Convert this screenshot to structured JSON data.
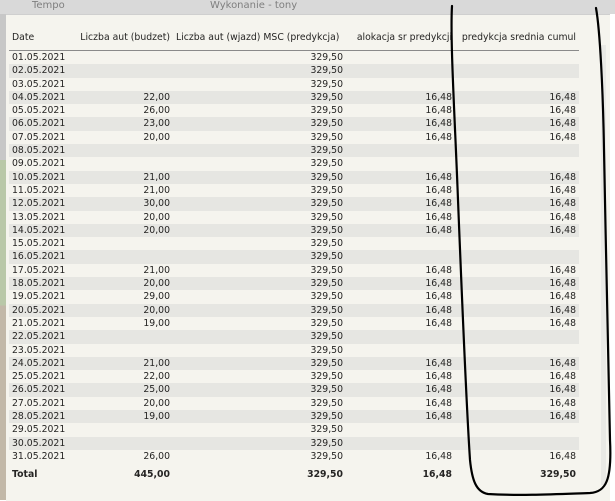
{
  "background": {
    "left_label": "Tempo",
    "right_label": "Wykonanie - tony"
  },
  "table": {
    "headers": [
      "Date",
      "Liczba aut (budzet)",
      "Liczba aut (wjazd)",
      "MSC (predykcja)",
      "alokacja sr predykcji",
      "predykcja srednia cumul"
    ],
    "rows": [
      {
        "date": "01.05.2021",
        "budzet": "",
        "msc": "329,50",
        "alok": "",
        "cumul": ""
      },
      {
        "date": "02.05.2021",
        "budzet": "",
        "msc": "329,50",
        "alok": "",
        "cumul": ""
      },
      {
        "date": "03.05.2021",
        "budzet": "",
        "msc": "329,50",
        "alok": "",
        "cumul": ""
      },
      {
        "date": "04.05.2021",
        "budzet": "22,00",
        "msc": "329,50",
        "alok": "16,48",
        "cumul": "16,48"
      },
      {
        "date": "05.05.2021",
        "budzet": "26,00",
        "msc": "329,50",
        "alok": "16,48",
        "cumul": "16,48"
      },
      {
        "date": "06.05.2021",
        "budzet": "23,00",
        "msc": "329,50",
        "alok": "16,48",
        "cumul": "16,48"
      },
      {
        "date": "07.05.2021",
        "budzet": "20,00",
        "msc": "329,50",
        "alok": "16,48",
        "cumul": "16,48"
      },
      {
        "date": "08.05.2021",
        "budzet": "",
        "msc": "329,50",
        "alok": "",
        "cumul": ""
      },
      {
        "date": "09.05.2021",
        "budzet": "",
        "msc": "329,50",
        "alok": "",
        "cumul": ""
      },
      {
        "date": "10.05.2021",
        "budzet": "21,00",
        "msc": "329,50",
        "alok": "16,48",
        "cumul": "16,48"
      },
      {
        "date": "11.05.2021",
        "budzet": "21,00",
        "msc": "329,50",
        "alok": "16,48",
        "cumul": "16,48"
      },
      {
        "date": "12.05.2021",
        "budzet": "30,00",
        "msc": "329,50",
        "alok": "16,48",
        "cumul": "16,48"
      },
      {
        "date": "13.05.2021",
        "budzet": "20,00",
        "msc": "329,50",
        "alok": "16,48",
        "cumul": "16,48"
      },
      {
        "date": "14.05.2021",
        "budzet": "20,00",
        "msc": "329,50",
        "alok": "16,48",
        "cumul": "16,48"
      },
      {
        "date": "15.05.2021",
        "budzet": "",
        "msc": "329,50",
        "alok": "",
        "cumul": ""
      },
      {
        "date": "16.05.2021",
        "budzet": "",
        "msc": "329,50",
        "alok": "",
        "cumul": ""
      },
      {
        "date": "17.05.2021",
        "budzet": "21,00",
        "msc": "329,50",
        "alok": "16,48",
        "cumul": "16,48"
      },
      {
        "date": "18.05.2021",
        "budzet": "20,00",
        "msc": "329,50",
        "alok": "16,48",
        "cumul": "16,48"
      },
      {
        "date": "19.05.2021",
        "budzet": "29,00",
        "msc": "329,50",
        "alok": "16,48",
        "cumul": "16,48"
      },
      {
        "date": "20.05.2021",
        "budzet": "20,00",
        "msc": "329,50",
        "alok": "16,48",
        "cumul": "16,48"
      },
      {
        "date": "21.05.2021",
        "budzet": "19,00",
        "msc": "329,50",
        "alok": "16,48",
        "cumul": "16,48"
      },
      {
        "date": "22.05.2021",
        "budzet": "",
        "msc": "329,50",
        "alok": "",
        "cumul": ""
      },
      {
        "date": "23.05.2021",
        "budzet": "",
        "msc": "329,50",
        "alok": "",
        "cumul": ""
      },
      {
        "date": "24.05.2021",
        "budzet": "21,00",
        "msc": "329,50",
        "alok": "16,48",
        "cumul": "16,48"
      },
      {
        "date": "25.05.2021",
        "budzet": "22,00",
        "msc": "329,50",
        "alok": "16,48",
        "cumul": "16,48"
      },
      {
        "date": "26.05.2021",
        "budzet": "25,00",
        "msc": "329,50",
        "alok": "16,48",
        "cumul": "16,48"
      },
      {
        "date": "27.05.2021",
        "budzet": "20,00",
        "msc": "329,50",
        "alok": "16,48",
        "cumul": "16,48"
      },
      {
        "date": "28.05.2021",
        "budzet": "19,00",
        "msc": "329,50",
        "alok": "16,48",
        "cumul": "16,48"
      },
      {
        "date": "29.05.2021",
        "budzet": "",
        "msc": "329,50",
        "alok": "",
        "cumul": ""
      },
      {
        "date": "30.05.2021",
        "budzet": "",
        "msc": "329,50",
        "alok": "",
        "cumul": ""
      },
      {
        "date": "31.05.2021",
        "budzet": "26,00",
        "msc": "329,50",
        "alok": "16,48",
        "cumul": "16,48"
      }
    ],
    "total": {
      "label": "Total",
      "budzet": "445,00",
      "msc": "329,50",
      "alok": "16,48",
      "cumul": "329,50"
    }
  },
  "colors": {
    "visual_bg": "#f5f4ee",
    "alt_row": "#e6e6e2",
    "annotation_ink": "#000000"
  }
}
